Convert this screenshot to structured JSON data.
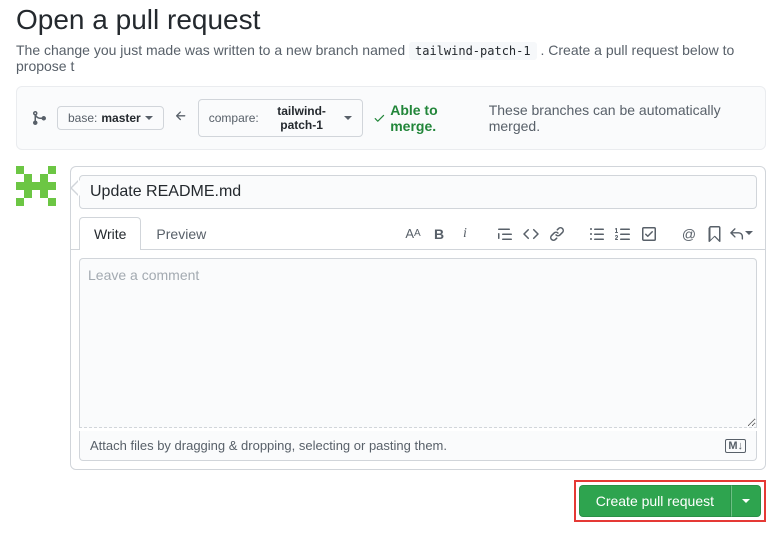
{
  "header": {
    "title": "Open a pull request",
    "subhead_before": "The change you just made was written to a new branch named ",
    "branch_name": "tailwind-patch-1",
    "subhead_after": ". Create a pull request below to propose t"
  },
  "compare": {
    "base_label": "base:",
    "base_branch": "master",
    "compare_label": "compare:",
    "compare_branch": "tailwind-patch-1",
    "status_strong": "Able to merge.",
    "status_text": "These branches can be automatically merged."
  },
  "form": {
    "title_value": "Update README.md",
    "tabs": {
      "write": "Write",
      "preview": "Preview"
    },
    "comment_placeholder": "Leave a comment",
    "attach_text": "Attach files by dragging & dropping, selecting or pasting them.",
    "submit_label": "Create pull request"
  }
}
